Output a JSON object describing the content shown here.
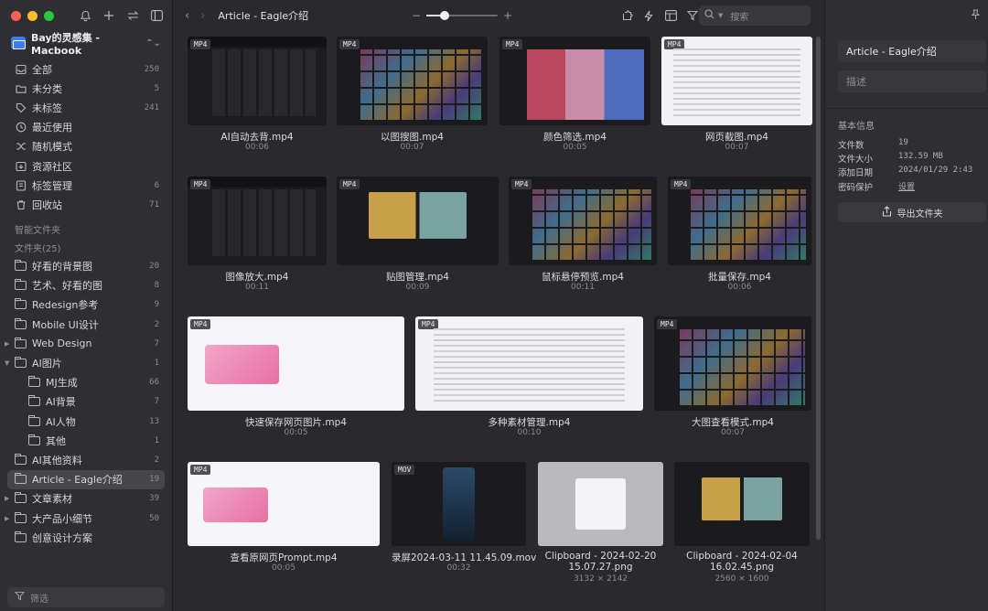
{
  "sidebar": {
    "library_name": "Bay的灵感集 - Macbook",
    "nav": [
      {
        "label": "全部",
        "count": "250",
        "icon": "inbox-icon"
      },
      {
        "label": "未分类",
        "count": "5",
        "icon": "folder-question-icon"
      },
      {
        "label": "未标签",
        "count": "241",
        "icon": "tag-off-icon"
      },
      {
        "label": "最近使用",
        "count": "",
        "icon": "clock-icon"
      },
      {
        "label": "随机模式",
        "count": "",
        "icon": "shuffle-icon"
      },
      {
        "label": "资源社区",
        "count": "",
        "icon": "community-icon"
      },
      {
        "label": "标签管理",
        "count": "6",
        "icon": "tag-icon"
      },
      {
        "label": "回收站",
        "count": "71",
        "icon": "trash-icon"
      }
    ],
    "smart_folders_label": "智能文件夹",
    "folders_label": "文件夹(25)",
    "folders": [
      {
        "label": "好看的背景图",
        "count": "20",
        "indent": 0,
        "caret": ""
      },
      {
        "label": "艺术、好看的图",
        "count": "8",
        "indent": 0,
        "caret": ""
      },
      {
        "label": "Redesign参考",
        "count": "9",
        "indent": 0,
        "caret": ""
      },
      {
        "label": "Mobile UI设计",
        "count": "2",
        "indent": 0,
        "caret": ""
      },
      {
        "label": "Web Design",
        "count": "7",
        "indent": 0,
        "caret": "▶"
      },
      {
        "label": "AI图片",
        "count": "1",
        "indent": 0,
        "caret": "▼"
      },
      {
        "label": "MJ生成",
        "count": "66",
        "indent": 1,
        "caret": ""
      },
      {
        "label": "AI背景",
        "count": "7",
        "indent": 1,
        "caret": ""
      },
      {
        "label": "AI人物",
        "count": "13",
        "indent": 1,
        "caret": ""
      },
      {
        "label": "其他",
        "count": "1",
        "indent": 1,
        "caret": ""
      },
      {
        "label": "AI其他资料",
        "count": "2",
        "indent": 0,
        "caret": ""
      },
      {
        "label": "Article - Eagle介绍",
        "count": "19",
        "indent": 0,
        "caret": "",
        "active": true
      },
      {
        "label": "文章素材",
        "count": "39",
        "indent": 0,
        "caret": "▶"
      },
      {
        "label": "大产品小细节",
        "count": "50",
        "indent": 0,
        "caret": "▶"
      },
      {
        "label": "创意设计方案",
        "count": "",
        "indent": 0,
        "caret": ""
      }
    ],
    "filter_placeholder": "筛选"
  },
  "toolbar": {
    "title": "Article - Eagle介绍",
    "search_placeholder": "搜索",
    "zoom_level": 0.25
  },
  "items": [
    {
      "name": "AI自动去背.mp4",
      "meta": "00:06",
      "badge": "MP4",
      "pattern": "pat-dark"
    },
    {
      "name": "以图搜图.mp4",
      "meta": "00:07",
      "badge": "MP4",
      "pattern": "pat-tiles"
    },
    {
      "name": "颜色筛选.mp4",
      "meta": "00:05",
      "badge": "MP4",
      "pattern": "pat-colors"
    },
    {
      "name": "网页截图.mp4",
      "meta": "00:07",
      "badge": "MP4",
      "pattern": "pat-light"
    },
    {
      "name": "图像放大.mp4",
      "meta": "00:11",
      "badge": "MP4",
      "pattern": "pat-dark"
    },
    {
      "name": "贴图管理.mp4",
      "meta": "00:09",
      "badge": "MP4",
      "pattern": "pat-art"
    },
    {
      "name": "鼠标悬停预览.mp4",
      "meta": "00:11",
      "badge": "MP4",
      "pattern": "pat-tiles"
    },
    {
      "name": "批量保存.mp4",
      "meta": "00:06",
      "badge": "MP4",
      "pattern": "pat-tiles"
    },
    {
      "name": "快速保存网页图片.mp4",
      "meta": "00:05",
      "badge": "MP4",
      "pattern": "pat-pink"
    },
    {
      "name": "多种素材管理.mp4",
      "meta": "00:10",
      "badge": "MP4",
      "pattern": "pat-light"
    },
    {
      "name": "大图查看模式.mp4",
      "meta": "00:07",
      "badge": "MP4",
      "pattern": "pat-tiles"
    },
    {
      "name": "查看原网页Prompt.mp4",
      "meta": "00:05",
      "badge": "MP4",
      "pattern": "pat-pink"
    },
    {
      "name": "录屏2024-03-11 11.45.09.mov",
      "meta": "00:32",
      "badge": "MOV",
      "pattern": "pat-phone"
    },
    {
      "name": "Clipboard - 2024-02-20 15.07.27.png",
      "meta": "3132 × 2142",
      "badge": "",
      "pattern": "pat-gray"
    },
    {
      "name": "Clipboard - 2024-02-04 16.02.45.png",
      "meta": "2560 × 1600",
      "badge": "",
      "pattern": "pat-art"
    }
  ],
  "inspector": {
    "name_value": "Article - Eagle介绍",
    "desc_placeholder": "描述",
    "section_title": "基本信息",
    "rows": [
      {
        "key": "文件数",
        "value": "19"
      },
      {
        "key": "文件大小",
        "value": "132.59 MB"
      },
      {
        "key": "添加日期",
        "value": "2024/01/29 2:43"
      },
      {
        "key": "密码保护",
        "value": "设置"
      }
    ],
    "export_label": "导出文件夹"
  }
}
